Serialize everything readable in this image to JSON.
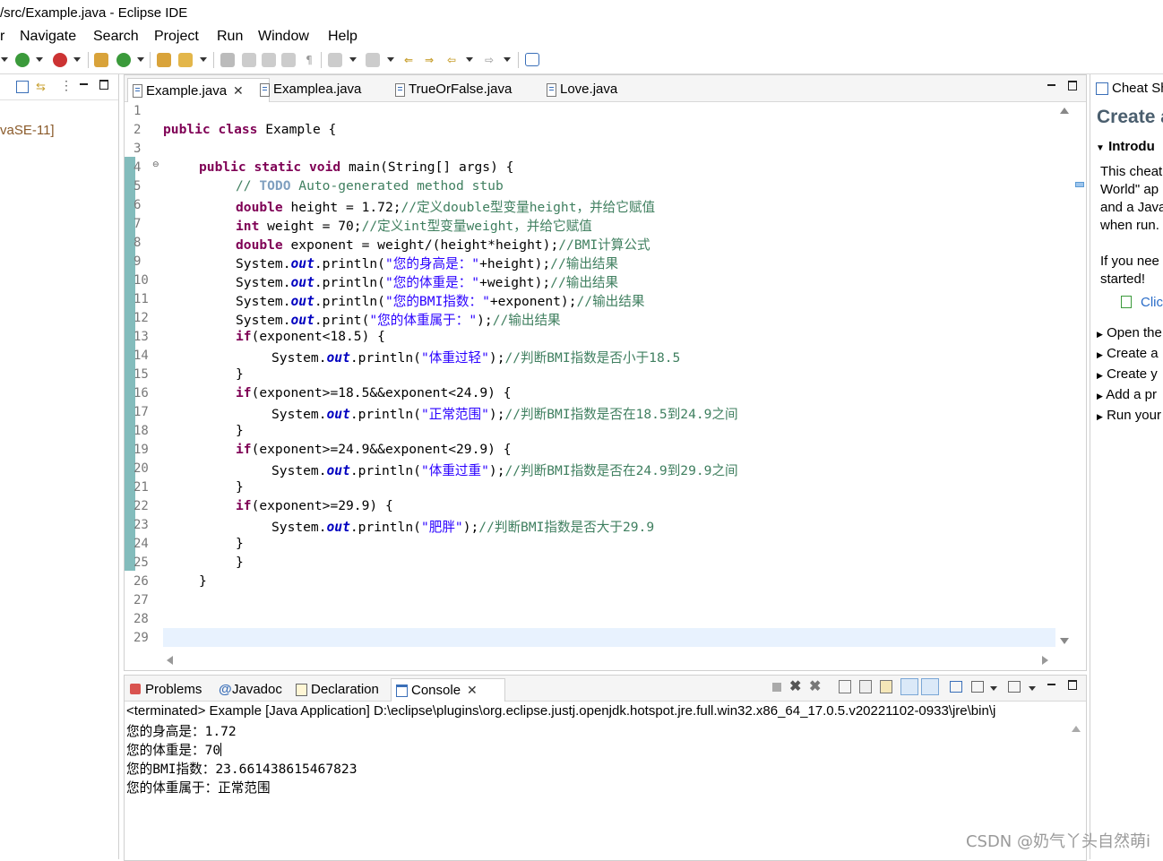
{
  "window": {
    "title": "/src/Example.java - Eclipse IDE"
  },
  "menu": {
    "partial_first": "r",
    "items": [
      "Navigate",
      "Search",
      "Project",
      "Run",
      "Window",
      "Help"
    ]
  },
  "left_panel": {
    "jre_label": "vaSE-11]"
  },
  "editor": {
    "tabs": [
      "Example.java",
      "Examplea.java",
      "TrueOrFalse.java",
      "Love.java"
    ],
    "active_tab": "Example.java",
    "line_numbers": [
      "1",
      "2",
      "3",
      "4",
      "5",
      "6",
      "7",
      "8",
      "9",
      "10",
      "11",
      "12",
      "13",
      "14",
      "15",
      "16",
      "17",
      "18",
      "19",
      "20",
      "21",
      "22",
      "23",
      "24",
      "25",
      "26",
      "27",
      "28",
      "29"
    ],
    "code": {
      "l2_kw": "public class",
      "l2_rest": " Example {",
      "l4_kw": "public static void",
      "l4_rest": " main(String[] args) {",
      "l5_c1": "// ",
      "l5_todo": "TODO",
      "l5_c2": " Auto-generated method stub",
      "l6_kw": "double",
      "l6_rest": " height = 1.72;",
      "l6_cm": "//定义double型变量height，并给它赋值",
      "l7_kw": "int",
      "l7_rest": " weight = 70;",
      "l7_cm": "//定义int型变量weight，并给它赋值",
      "l8_kw": "double",
      "l8_rest": " exponent = weight/(height*height);",
      "l8_cm": "//BMI计算公式",
      "sys": "System.",
      "out": "out",
      "l9_a": ".println(",
      "l9_s": "\"您的身高是：\"",
      "l9_b": "+height);",
      "l9_cm": "//输出结果",
      "l10_a": ".println(",
      "l10_s": "\"您的体重是：\"",
      "l10_b": "+weight);",
      "l10_cm": "//输出结果",
      "l11_a": ".println(",
      "l11_s": "\"您的BMI指数：\"",
      "l11_b": "+exponent);",
      "l11_cm": "//输出结果",
      "l12_a": ".print(",
      "l12_s": "\"您的体重属于：\"",
      "l12_b": ");",
      "l12_cm": "//输出结果",
      "if": "if",
      "l13_rest": "(exponent<18.5) {",
      "l14_a": ".println(",
      "l14_s": "\"体重过轻\"",
      "l14_b": ");",
      "l14_cm": "//判断BMI指数是否小于18.5",
      "brace": "}",
      "l16_rest": "(exponent>=18.5&&exponent<24.9) {",
      "l17_a": ".println(",
      "l17_s": "\"正常范围\"",
      "l17_b": ");",
      "l17_cm": "//判断BMI指数是否在18.5到24.9之间",
      "l19_rest": "(exponent>=24.9&&exponent<29.9) {",
      "l20_a": ".println(",
      "l20_s": "\"体重过重\"",
      "l20_b": ");",
      "l20_cm": "//判断BMI指数是否在24.9到29.9之间",
      "l22_rest": "(exponent>=29.9) {",
      "l23_a": ".println(",
      "l23_s": "\"肥胖\"",
      "l23_b": ");",
      "l23_cm": "//判断BMI指数是否大于29.9"
    }
  },
  "console": {
    "tabs": [
      "Problems",
      "Javadoc",
      "Declaration",
      "Console"
    ],
    "active_tab": "Console",
    "header": "<terminated> Example [Java Application] D:\\eclipse\\plugins\\org.eclipse.justj.openjdk.hotspot.jre.full.win32.x86_64_17.0.5.v20221102-0933\\jre\\bin\\j",
    "output": [
      "您的身高是：1.72",
      "您的体重是：70",
      "您的BMI指数：23.661438615467823",
      "您的体重属于：正常范围"
    ]
  },
  "cheat_sheet": {
    "tab": "Cheat Sh",
    "title": "Create a",
    "section": "Introdu",
    "intro_lines": [
      "This cheat",
      "World\" ap",
      "and a Java",
      "when run."
    ],
    "need_lines": [
      "If you nee",
      "started!"
    ],
    "click_link": "Clic",
    "steps": [
      "Open the",
      "Create a",
      "Create y",
      "Add a pr",
      "Run your"
    ]
  },
  "watermark": "CSDN @奶气丫头自然萌i"
}
